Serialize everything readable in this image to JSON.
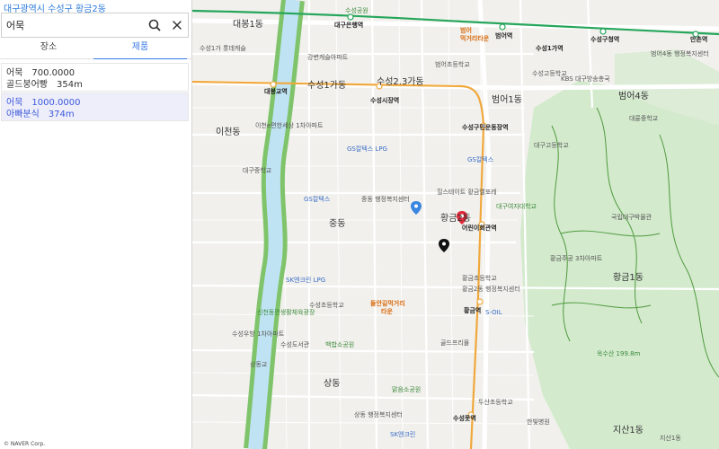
{
  "header": {
    "region": "대구광역시 수성구 황금2동"
  },
  "search": {
    "value": "어묵"
  },
  "tabs": {
    "place": "장소",
    "title": "제품"
  },
  "results": [
    {
      "line1_name": "어묵",
      "line1_value": "700.0000",
      "line2_name": "골드붕어빵",
      "line2_value": "354m",
      "selected": false
    },
    {
      "line1_name": "어묵",
      "line1_value": "1000.0000",
      "line2_name": "아빠분식",
      "line2_value": "374m",
      "selected": true
    }
  ],
  "colors": {
    "accent": "#3a79e6",
    "selected_text": "#3b59d9",
    "selected_bg": "#eeeefb",
    "river": "#bfe3f3",
    "river_bank": "#7fc46a",
    "subway_line2": "#26a65b",
    "subway_line3": "#f0a83c",
    "park": "#cde8c6",
    "pin_blue": "#3a86e0",
    "pin_red": "#e02a3a",
    "pin_black": "#111111"
  },
  "map": {
    "labels": {
      "l_daebong1": "대봉1동",
      "l_suseong_park": "수성공원",
      "l_daegu_bank_station": "대구은행역",
      "l_beomeo_station": "범어역",
      "l_suseong_gu_office_station": "수성구청역",
      "l_mansun_station": "만촌역",
      "l_beomeo": "범어",
      "l_meokgeori": "먹거리타운",
      "l_beomeo1": "범어1동",
      "l_beomeo4": "범어4동",
      "l_daebong_gyo": "대봉교역",
      "l_suseong1ga": "수성1가동",
      "l_suseong23ga": "수성2.3가동",
      "l_suseong_market": "수성시장역",
      "l_icheon": "이천동",
      "l_suseong_gu_stadium": "수성구민운동장역",
      "l_jung": "중동",
      "l_hwanggeum2": "황금2동",
      "l_eorini": "어린이회관역",
      "l_hwanggeum1": "황금1동",
      "l_hwanggeum_station": "황금역",
      "l_deulangil": "들안길먹거리",
      "l_tawn": "타운",
      "l_sang": "상동",
      "l_suseong_mot": "수성못역",
      "l_jisan1": "지산1동",
      "l_gongpyeong_school": "대구중학교",
      "l_gs_lpg": "GS칼텍스 LPG",
      "l_gs1": "GS칼텍스",
      "l_gs2": "GS칼텍스",
      "l_sk_lpg": "SK엔크린 LPG",
      "l_sk": "SK엔크린",
      "l_soil": "S-OIL",
      "l_hillstate": "힐스테이트 황금엘포레",
      "l_daegu_uni": "대구여자대학교",
      "l_national_museum": "국립대구박물관",
      "l_hwanggeum_school": "황금초등학교",
      "l_suseong_school": "수성초등학교",
      "l_gold_market": "골드프리몰",
      "l_mugaksan": "욱수산 199.8m",
      "l_beomeo_school": "범어초등학교",
      "l_suseong_hs": "수성고등학교",
      "l_daeryun": "대륜중학교",
      "l_suseong_library": "수성도서관",
      "l_welfare": "중동 행정복지센터",
      "l_sangdong_welfare": "상동 행정복지센터",
      "l_hwanggeum_jugong": "황금주공 3차아파트",
      "l_hwanggeum2_welfare": "황금2동 행정복지센터",
      "l_sinchun_park": "신천동편생활체육광장",
      "l_bakdal_park": "백합소공원",
      "l_maekdong_park": "맑음소공원",
      "l_mansi": "수성우방 1차아파트",
      "l_beomeo_welfare": "범어4동 행정복지센터",
      "l_jisan_gate": "수성1가 롯데캐슬",
      "l_icheon_lotte": "이천e편한세상 1차아파트",
      "l_suseong_station_st": "수성1가역",
      "l_daegu_high": "대구고등학교",
      "l_dusan": "두산초등학교",
      "l_hanbit": "한빛병원",
      "l_kbs": "KBS 대구방송총국",
      "l_gangbyeon": "강변캐슬아파트",
      "l_sangdong_gyo": "상동교",
      "l_jisan1_lbl": "지산1동"
    }
  },
  "copyright": "© NAVER Corp."
}
